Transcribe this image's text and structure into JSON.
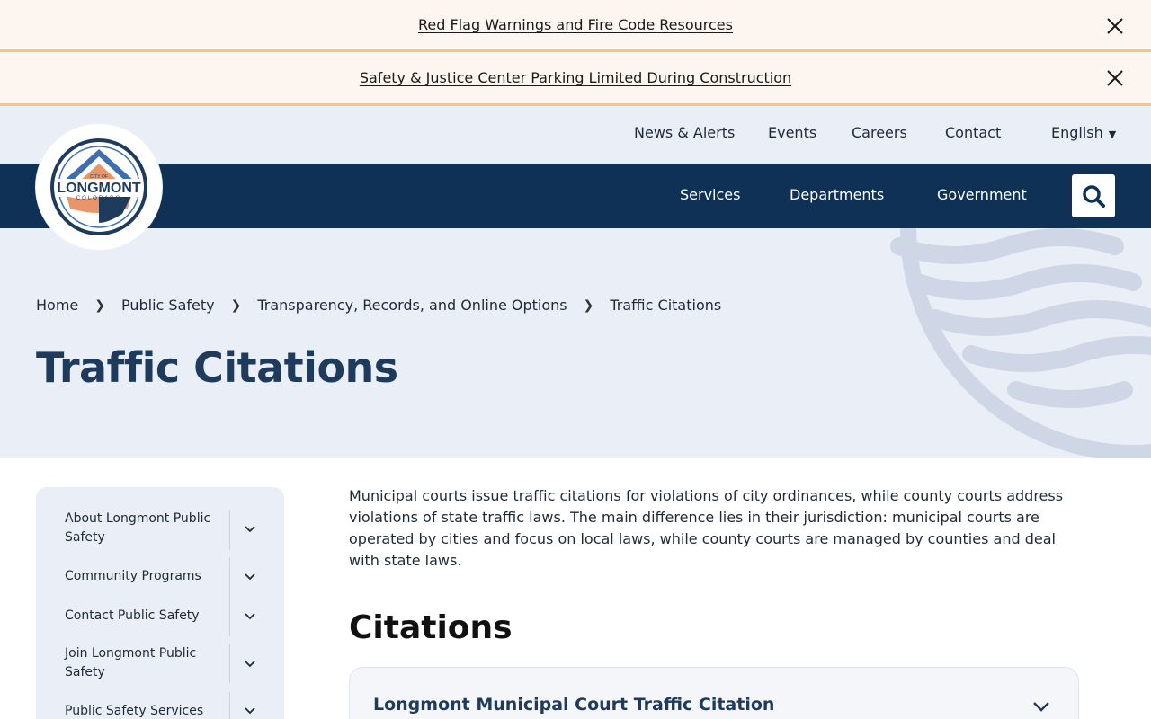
{
  "alerts": [
    {
      "text": "Red Flag Warnings and Fire Code Resources"
    },
    {
      "text": "Safety & Justice Center Parking Limited During Construction"
    }
  ],
  "logo": {
    "top_text": "CITY OF",
    "name": "LONGMONT",
    "sub": "COLORADO"
  },
  "utility_nav": {
    "news": "News & Alerts",
    "events": "Events",
    "careers": "Careers",
    "contact": "Contact",
    "language": "English"
  },
  "main_nav": {
    "services": "Services",
    "departments": "Departments",
    "government": "Government"
  },
  "breadcrumb": [
    "Home",
    "Public Safety",
    "Transparency, Records, and Online Options",
    "Traffic Citations"
  ],
  "page_title": "Traffic Citations",
  "sidebar": {
    "items": [
      {
        "label": "About Longmont Public Safety"
      },
      {
        "label": "Community Programs"
      },
      {
        "label": "Contact Public Safety"
      },
      {
        "label": "Join Longmont Public Safety"
      },
      {
        "label": "Public Safety Services"
      }
    ]
  },
  "content": {
    "intro": "Municipal courts issue traffic citations for violations of city ordinances, while county courts address violations of state traffic laws. The main difference lies in their jurisdiction: municipal courts are operated by cities and focus on local laws, while county courts are managed by counties and deal with state laws.",
    "section_heading": "Citations",
    "accordion_title": "Longmont Municipal Court Traffic Citation"
  },
  "colors": {
    "navy": "#0f3156",
    "alert_bg": "#fdf5ef",
    "alert_border": "#f1c68b",
    "light_bg": "#e9eef7",
    "logo_orange": "#e8956a",
    "logo_blue": "#3d6fb0"
  }
}
